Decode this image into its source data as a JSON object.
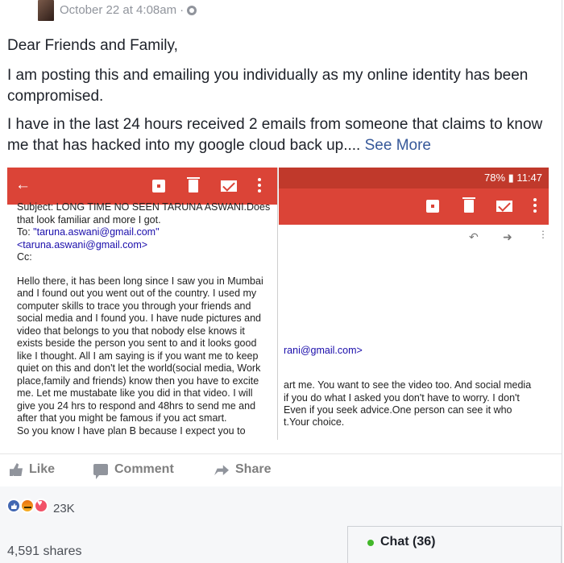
{
  "header": {
    "timestamp": "October 22 at 4:08am",
    "separator": "·"
  },
  "post": {
    "para1": "Dear Friends and Family,",
    "para2": "I am posting this and emailing you individually as my online identity has been compromised.",
    "para3": "I have in the last 24 hours received 2 emails from someone that claims to know me that has hacked into my google cloud back up....",
    "see_more": "See More"
  },
  "screenshot_left": {
    "subject": "Subject: LONG TIME NO SEEN TARUNA ASWANI.Does",
    "line2": "that look familiar and more I got.",
    "to_label": "To: ",
    "to_value": "\"taruna.aswani@gmail.com\"",
    "to_value2": "<taruna.aswani@gmail.com>",
    "cc": "Cc:",
    "body": "Hello there, it has been long since I saw you in Mumbai and I found out you went out of the country. I used my computer skills to trace you through your friends and social media and I found you. I have nude pictures and video that belongs to you that nobody else knows it exists beside the person you sent to and it looks good like I thought. All I am saying is if you want me to keep quiet on this and don't let the world(social media, Work place,family and friends) know then you have to excite me. Let me mustabate like you did in that video. I will give you 24 hrs to respond  and 48hrs to send me and after that you might be famous if you act smart.",
    "cut_line": "So you know I have plan B because I expect you to"
  },
  "screenshot_right": {
    "status": "78% ▮ 11:47",
    "email_fragment": "rani@gmail.com>",
    "line1": "art me. You want to see the video too. And social media",
    "line2": "if you do what I asked you don't have to worry. I don't",
    "line3": "Even if you seek advice.One person can see it who",
    "line4": "t.Your choice."
  },
  "actions": {
    "like": "Like",
    "comment": "Comment",
    "share": "Share"
  },
  "reactions": {
    "count": "23K",
    "shares": "4,591 shares"
  },
  "chat": {
    "label": "Chat (36)"
  },
  "colors": {
    "gmail_red": "#db4437",
    "fb_link": "#365899",
    "online_green": "#42b72a"
  }
}
